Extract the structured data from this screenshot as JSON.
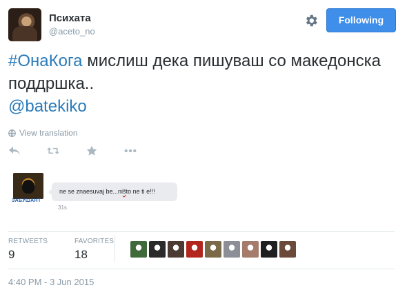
{
  "user": {
    "display_name": "Психата",
    "screen_name": "@aceto_no",
    "follow_label": "Following",
    "settings_icon": "gear-icon"
  },
  "tweet": {
    "hashtag": "#ОнаКога",
    "text": " мислиш дека пишуваш со македонска поддршка..",
    "mention": "@batekiko",
    "translate_label": "View translation"
  },
  "actions": {
    "reply_icon": "reply-icon",
    "retweet_icon": "retweet-icon",
    "favorite_icon": "star-icon",
    "more_icon": "more-icon"
  },
  "quoted_image": {
    "caption": "ЗАБУШАНТ",
    "message_pre": "ne se znaesuvaj be...ni",
    "message_typo": "š",
    "message_post": "to ne ti e!!!",
    "time": "31s"
  },
  "stats": {
    "retweets_label": "RETWEETS",
    "retweets_value": "9",
    "favorites_label": "FAVORITES",
    "favorites_value": "18"
  },
  "favoriters": [
    {
      "color": "#3f6b3a"
    },
    {
      "color": "#2a2a2a"
    },
    {
      "color": "#4b3b33"
    },
    {
      "color": "#b3261e"
    },
    {
      "color": "#7a6a48"
    },
    {
      "color": "#8d8f96"
    },
    {
      "color": "#a57b6c"
    },
    {
      "color": "#1f1f1f"
    },
    {
      "color": "#6b4a3a"
    }
  ],
  "timestamp": "4:40 PM - 3 Jun 2015",
  "colors": {
    "accent": "#3f8ee9",
    "link": "#2b7bb9",
    "muted": "#8899a6"
  }
}
